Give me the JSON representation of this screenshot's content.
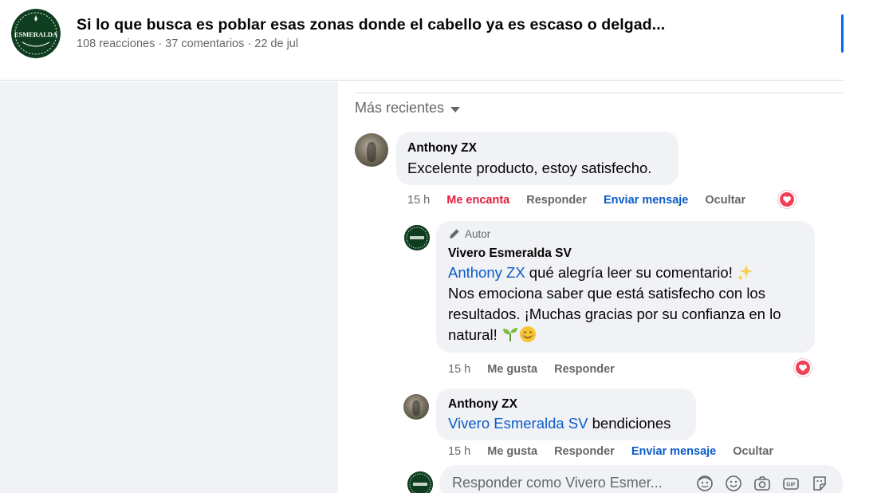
{
  "post": {
    "title": "Si lo que busca es poblar esas zonas donde el cabello ya es escaso o delgad...",
    "meta": "108 reacciones · 37 comentarios · 22 de jul",
    "logo_text": "ESMERALDA"
  },
  "comments": {
    "sort_label": "Más recientes",
    "items": [
      {
        "author": "Anthony ZX",
        "text": "Excelente producto, estoy satisfecho.",
        "time": "15 h",
        "reaction_label": "Me encanta",
        "reply_label": "Responder",
        "message_label": "Enviar mensaje",
        "hide_label": "Ocultar"
      }
    ],
    "replies": [
      {
        "badge": "Autor",
        "author": "Vivero Esmeralda SV",
        "mention": "Anthony ZX",
        "text_line1": " qué alegría leer su comentario! ",
        "text_line2": "Nos emociona saber que está satisfecho con los",
        "text_line3": "resultados. ¡Muchas gracias por su confianza en lo",
        "text_line4": "natural! ",
        "time": "15 h",
        "like_label": "Me gusta",
        "reply_label": "Responder"
      },
      {
        "author": "Anthony ZX",
        "mention": "Vivero Esmeralda SV",
        "text": " bendiciones",
        "time": "15 h",
        "like_label": "Me gusta",
        "reply_label": "Responder",
        "message_label": "Enviar mensaje",
        "hide_label": "Ocultar"
      }
    ],
    "reply_box_placeholder": "Responder como Vivero Esmer..."
  },
  "colors": {
    "accent": "#0866ff",
    "link": "#0a5bc9",
    "love": "#e41e3f",
    "bubble": "#f0f2f5",
    "brand_green": "#0f3d1f"
  },
  "icons": [
    "heart-reaction-icon",
    "pencil-icon",
    "sparkles-emoji",
    "seedling-emoji",
    "smile-emoji",
    "avatar-icon",
    "emoji-icon",
    "camera-icon",
    "gif-icon",
    "sticker-icon"
  ]
}
